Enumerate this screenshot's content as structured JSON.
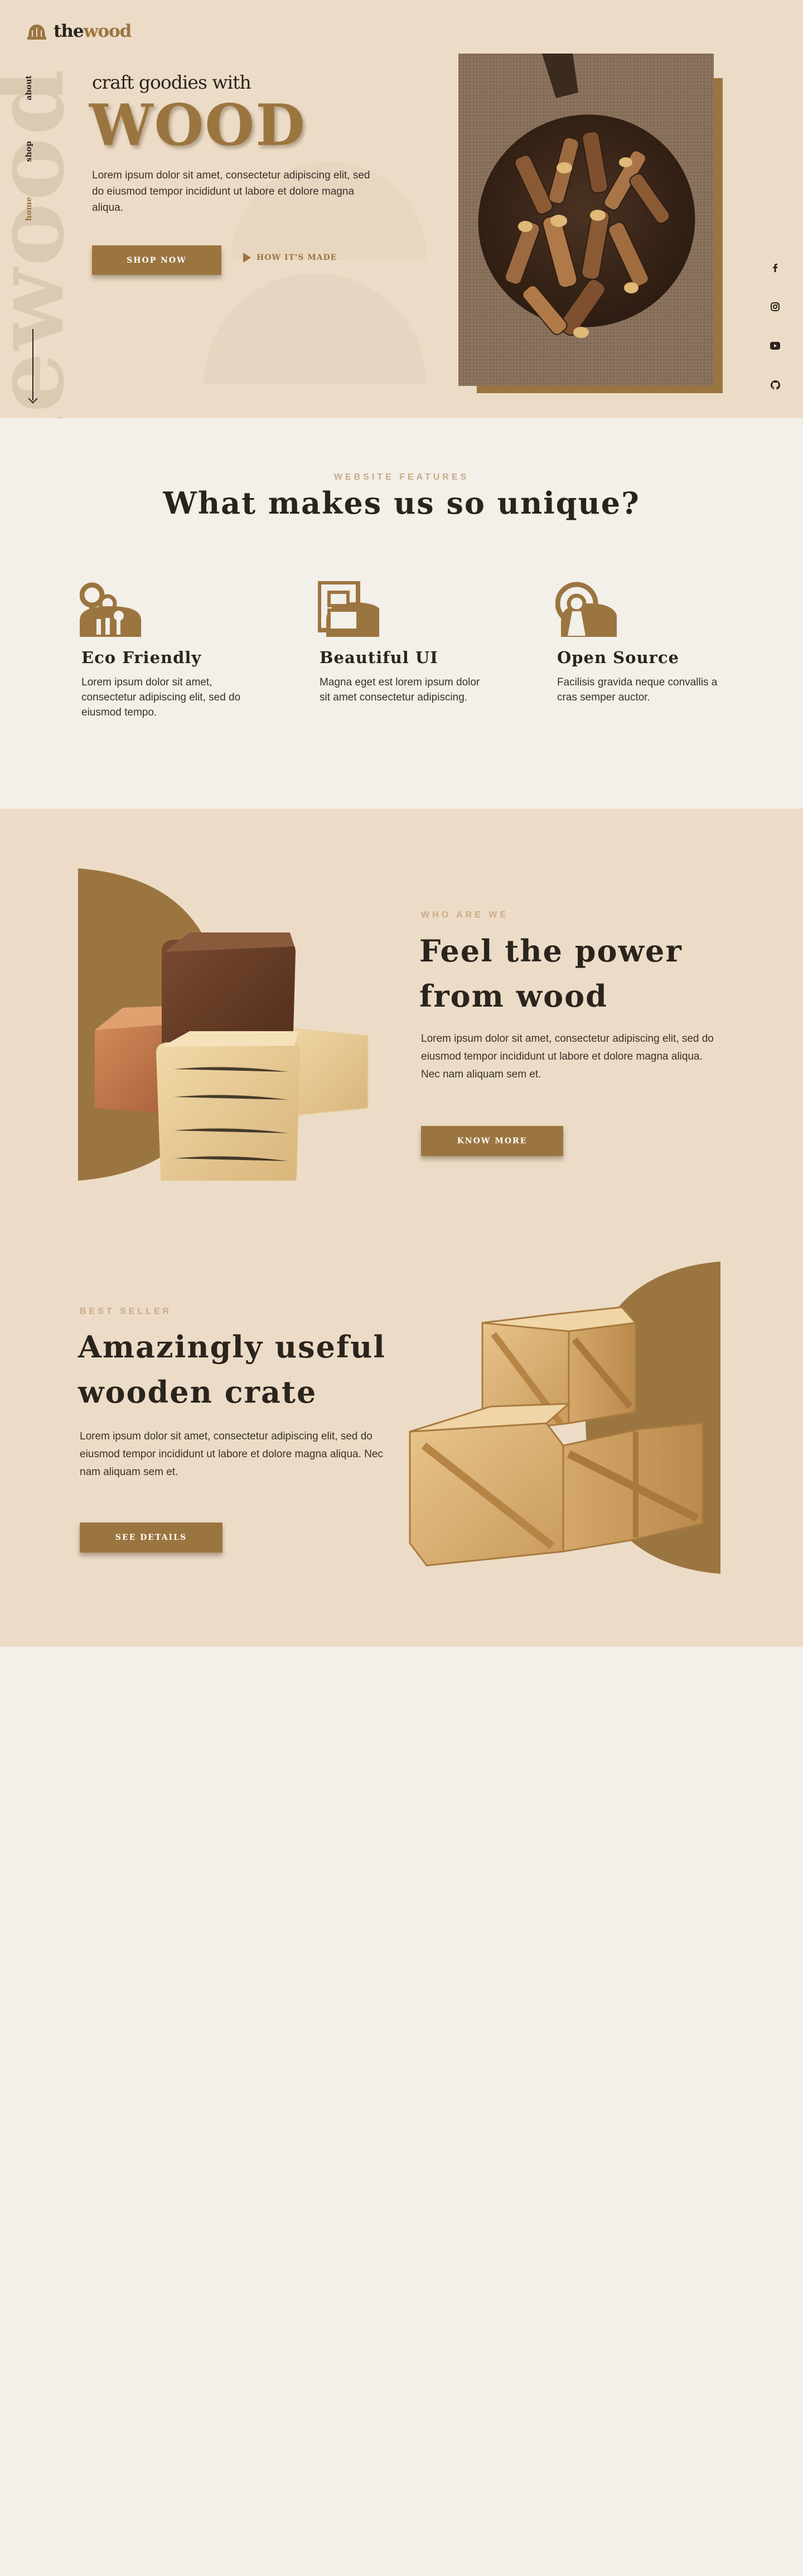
{
  "brand": {
    "prefix": "the",
    "name": "wood"
  },
  "sidenav": {
    "items": [
      "about",
      "shop",
      "home"
    ],
    "watermark": "Thewood"
  },
  "hero": {
    "tagline": "craft goodies with",
    "headline": "WOOD",
    "text": "Lorem ipsum dolor sit amet, consectetur adipiscing elit, sed do eiusmod tempor incididunt ut labore et dolore magna aliqua.",
    "shop_button": "SHOP NOW",
    "how_link": "HOW IT'S MADE"
  },
  "socials": [
    "facebook-icon",
    "instagram-icon",
    "youtube-icon",
    "github-icon"
  ],
  "features": {
    "eyebrow": "WEBSITE FEATURES",
    "title": "What makes us so unique?",
    "items": [
      {
        "icon": "trees-icon",
        "title": "Eco Friendly",
        "text": "Lorem ipsum dolor sit amet, consectetur adipiscing elit, sed do eiusmod tempo."
      },
      {
        "icon": "layout-icon",
        "title": "Beautiful UI",
        "text": "Magna eget est lorem ipsum dolor sit amet consectetur adipiscing."
      },
      {
        "icon": "open-source-icon",
        "title": "Open Source",
        "text": "Facilisis gravida neque convallis a cras semper auctor."
      }
    ]
  },
  "power": {
    "eyebrow": "WHO ARE WE",
    "title_line1": "Feel the power",
    "title_line2": "from wood",
    "text": "Lorem ipsum dolor sit amet, consectetur adipiscing elit, sed do eiusmod tempor incididunt ut labore et dolore magna aliqua. Nec nam aliquam sem et.",
    "button": "KNOW MORE"
  },
  "bestseller": {
    "eyebrow": "BEST SELLER",
    "title_line1": "Amazingly useful",
    "title_line2": "wooden crate",
    "text": "Lorem ipsum dolor sit amet, consectetur adipiscing elit, sed do eiusmod tempor incididunt ut labore et dolore magna aliqua. Nec nam aliquam sem et.",
    "button": "SEE DETAILS"
  },
  "colors": {
    "accent": "#9b7540",
    "hero_bg": "#ecdcc7",
    "light_bg": "#f3efe9",
    "text": "#2a241d",
    "eyebrow": "#c9ab87"
  }
}
